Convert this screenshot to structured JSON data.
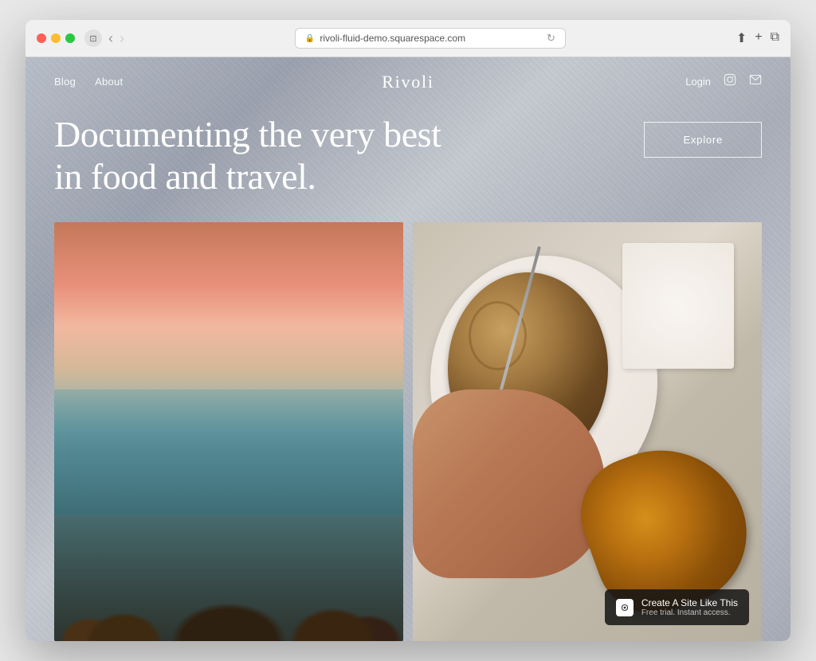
{
  "browser": {
    "url": "rivoli-fluid-demo.squarespace.com",
    "back_btn": "‹",
    "forward_btn": "›"
  },
  "nav": {
    "links": [
      {
        "label": "Blog",
        "id": "blog"
      },
      {
        "label": "About",
        "id": "about"
      }
    ],
    "brand": "Rivoli",
    "login": "Login"
  },
  "hero": {
    "headline": "Documenting the very best in food and travel.",
    "explore_btn": "Explore"
  },
  "banner": {
    "logo_text": "◈",
    "main_text": "Create A Site Like This",
    "sub_text": "Free trial. Instant access."
  }
}
